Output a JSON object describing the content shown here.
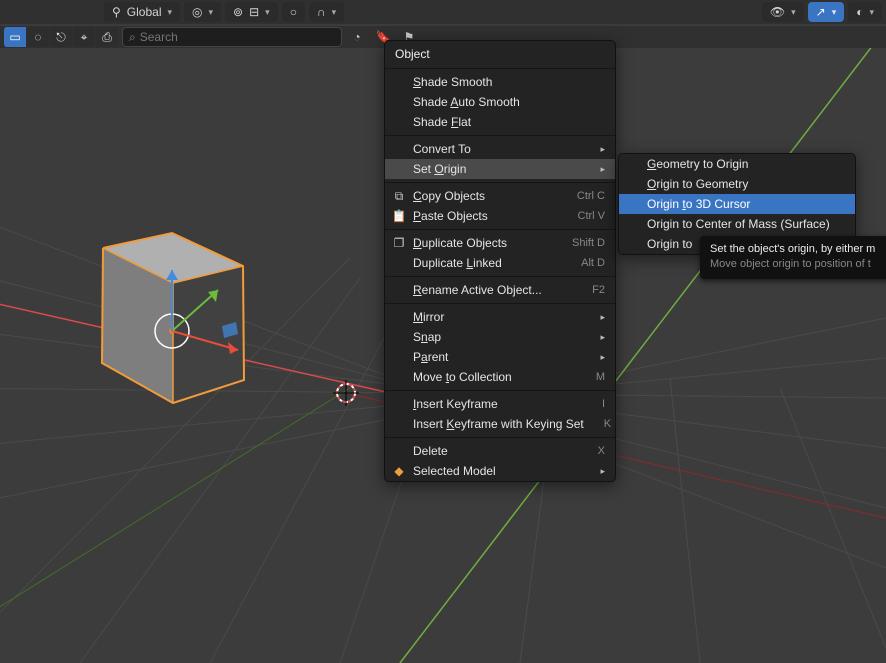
{
  "header": {
    "transform_label": "Global",
    "search_placeholder": "Search"
  },
  "menu": {
    "title": "Object",
    "items": {
      "shade_smooth": "Shade Smooth",
      "shade_auto": "Shade Auto Smooth",
      "shade_flat": "Shade Flat",
      "convert": "Convert To",
      "set_origin": "Set Origin",
      "copy": "Copy Objects",
      "copy_sc": "Ctrl C",
      "paste": "Paste Objects",
      "paste_sc": "Ctrl V",
      "dup": "Duplicate Objects",
      "dup_sc": "Shift D",
      "dup_linked": "Duplicate Linked",
      "dup_linked_sc": "Alt D",
      "rename": "Rename Active Object...",
      "rename_sc": "F2",
      "mirror": "Mirror",
      "snap": "Snap",
      "parent": "Parent",
      "move_col": "Move to Collection",
      "move_col_sc": "M",
      "ins_key": "Insert Keyframe",
      "ins_key_sc": "I",
      "ins_key_set": "Insert Keyframe with Keying Set",
      "ins_key_set_sc": "K",
      "delete": "Delete",
      "delete_sc": "X",
      "selected_model": "Selected Model"
    }
  },
  "submenu": {
    "geom_to_origin": "Geometry to Origin",
    "origin_to_geom": "Origin to Geometry",
    "origin_to_cursor": "Origin to 3D Cursor",
    "origin_com_surface": "Origin to Center of Mass (Surface)",
    "origin_to": "Origin to"
  },
  "tooltip": {
    "line1": "Set the object's origin, by either m",
    "line2": "Move object origin to position of t"
  }
}
